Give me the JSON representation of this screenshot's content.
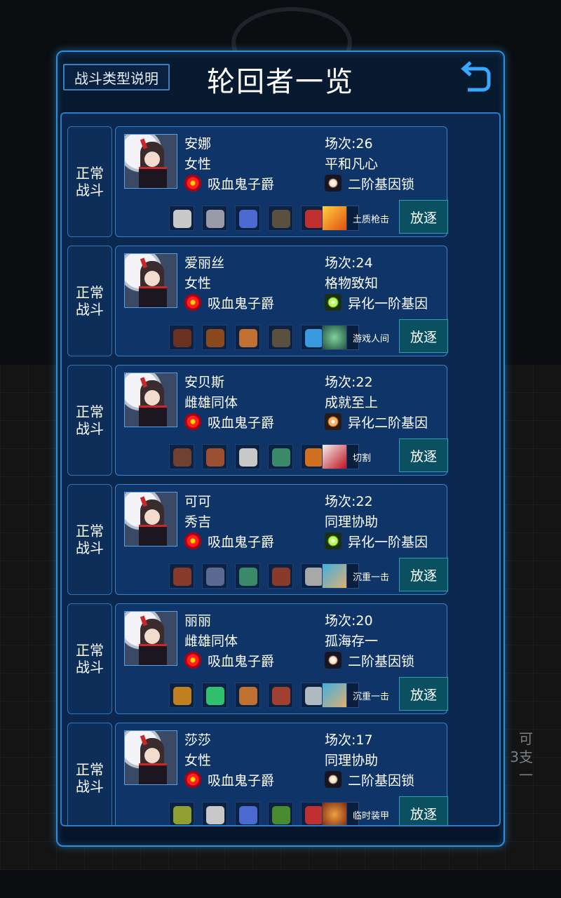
{
  "header": {
    "info_button": "战斗类型说明",
    "title": "轮回者一览"
  },
  "background": {
    "lines": [
      "可",
      "3支",
      "一"
    ]
  },
  "labels": {
    "exile": "放逐"
  },
  "colors": {
    "accent": "#2d8fd8",
    "panel": "#081a30",
    "card": "#0e3468",
    "exile_button": "#0a5060"
  },
  "roster": [
    {
      "battle_type": "正常\n战斗",
      "name": "安娜",
      "gender": "女性",
      "class": "吸血鬼子爵",
      "matches": "场次:26",
      "trait": "平和凡心",
      "gene": "二阶基因锁",
      "gene_icon": "star-icon",
      "equipment": [
        "necklace-icon",
        "armor-icon",
        "arm-guard-icon",
        "glove-icon",
        "dagger-icon",
        "empty"
      ],
      "skill": "土质枪击",
      "skill_icon": "fire-shot-icon"
    },
    {
      "battle_type": "正常\n战斗",
      "name": "爱丽丝",
      "gender": "女性",
      "class": "吸血鬼子爵",
      "matches": "场次:24",
      "trait": "格物致知",
      "gene": "异化一阶基因",
      "gene_icon": "star-green",
      "equipment": [
        "hat-icon",
        "ore-icon",
        "bracer-icon",
        "glove-icon",
        "blue-blade-icon",
        "empty"
      ],
      "skill": "游戏人间",
      "skill_icon": "frog-icon"
    },
    {
      "battle_type": "正常\n战斗",
      "name": "安贝斯",
      "gender": "雌雄同体",
      "class": "吸血鬼子爵",
      "matches": "场次:22",
      "trait": "成就至上",
      "gene": "异化二阶基因",
      "gene_icon": "star-orange",
      "equipment": [
        "boots-icon",
        "gauntlet-icon",
        "necklace-icon",
        "green-armor-icon",
        "sword-icon",
        "empty"
      ],
      "skill": "切割",
      "skill_icon": "slash-icon"
    },
    {
      "battle_type": "正常\n战斗",
      "name": "可可",
      "gender": "秀吉",
      "class": "吸血鬼子爵",
      "matches": "场次:22",
      "trait": "同理协助",
      "gene": "异化一阶基因",
      "gene_icon": "star-green",
      "equipment": [
        "leather-armor-icon",
        "greaves-icon",
        "green-armor-icon",
        "leather-armor-icon",
        "rifle-icon",
        "empty"
      ],
      "skill": "沉重一击",
      "skill_icon": "punch-icon"
    },
    {
      "battle_type": "正常\n战斗",
      "name": "丽丽",
      "gender": "雌雄同体",
      "class": "吸血鬼子爵",
      "matches": "场次:20",
      "trait": "孤海存一",
      "gene": "二阶基因锁",
      "gene_icon": "star-icon",
      "equipment": [
        "treasure-icon",
        "potion-icon",
        "bracer-icon",
        "helmet-icon",
        "pistol-icon",
        "empty"
      ],
      "skill": "沉重一击",
      "skill_icon": "punch-icon"
    },
    {
      "battle_type": "正常\n战斗",
      "name": "莎莎",
      "gender": "女性",
      "class": "吸血鬼子爵",
      "matches": "场次:17",
      "trait": "同理协助",
      "gene": "二阶基因锁",
      "gene_icon": "star-icon",
      "equipment": [
        "scroll-icon",
        "necklace-icon",
        "arm-guard-icon",
        "serpent-icon",
        "dagger-icon",
        "empty"
      ],
      "skill": "临时装甲",
      "skill_icon": "shield-orb-icon"
    }
  ]
}
